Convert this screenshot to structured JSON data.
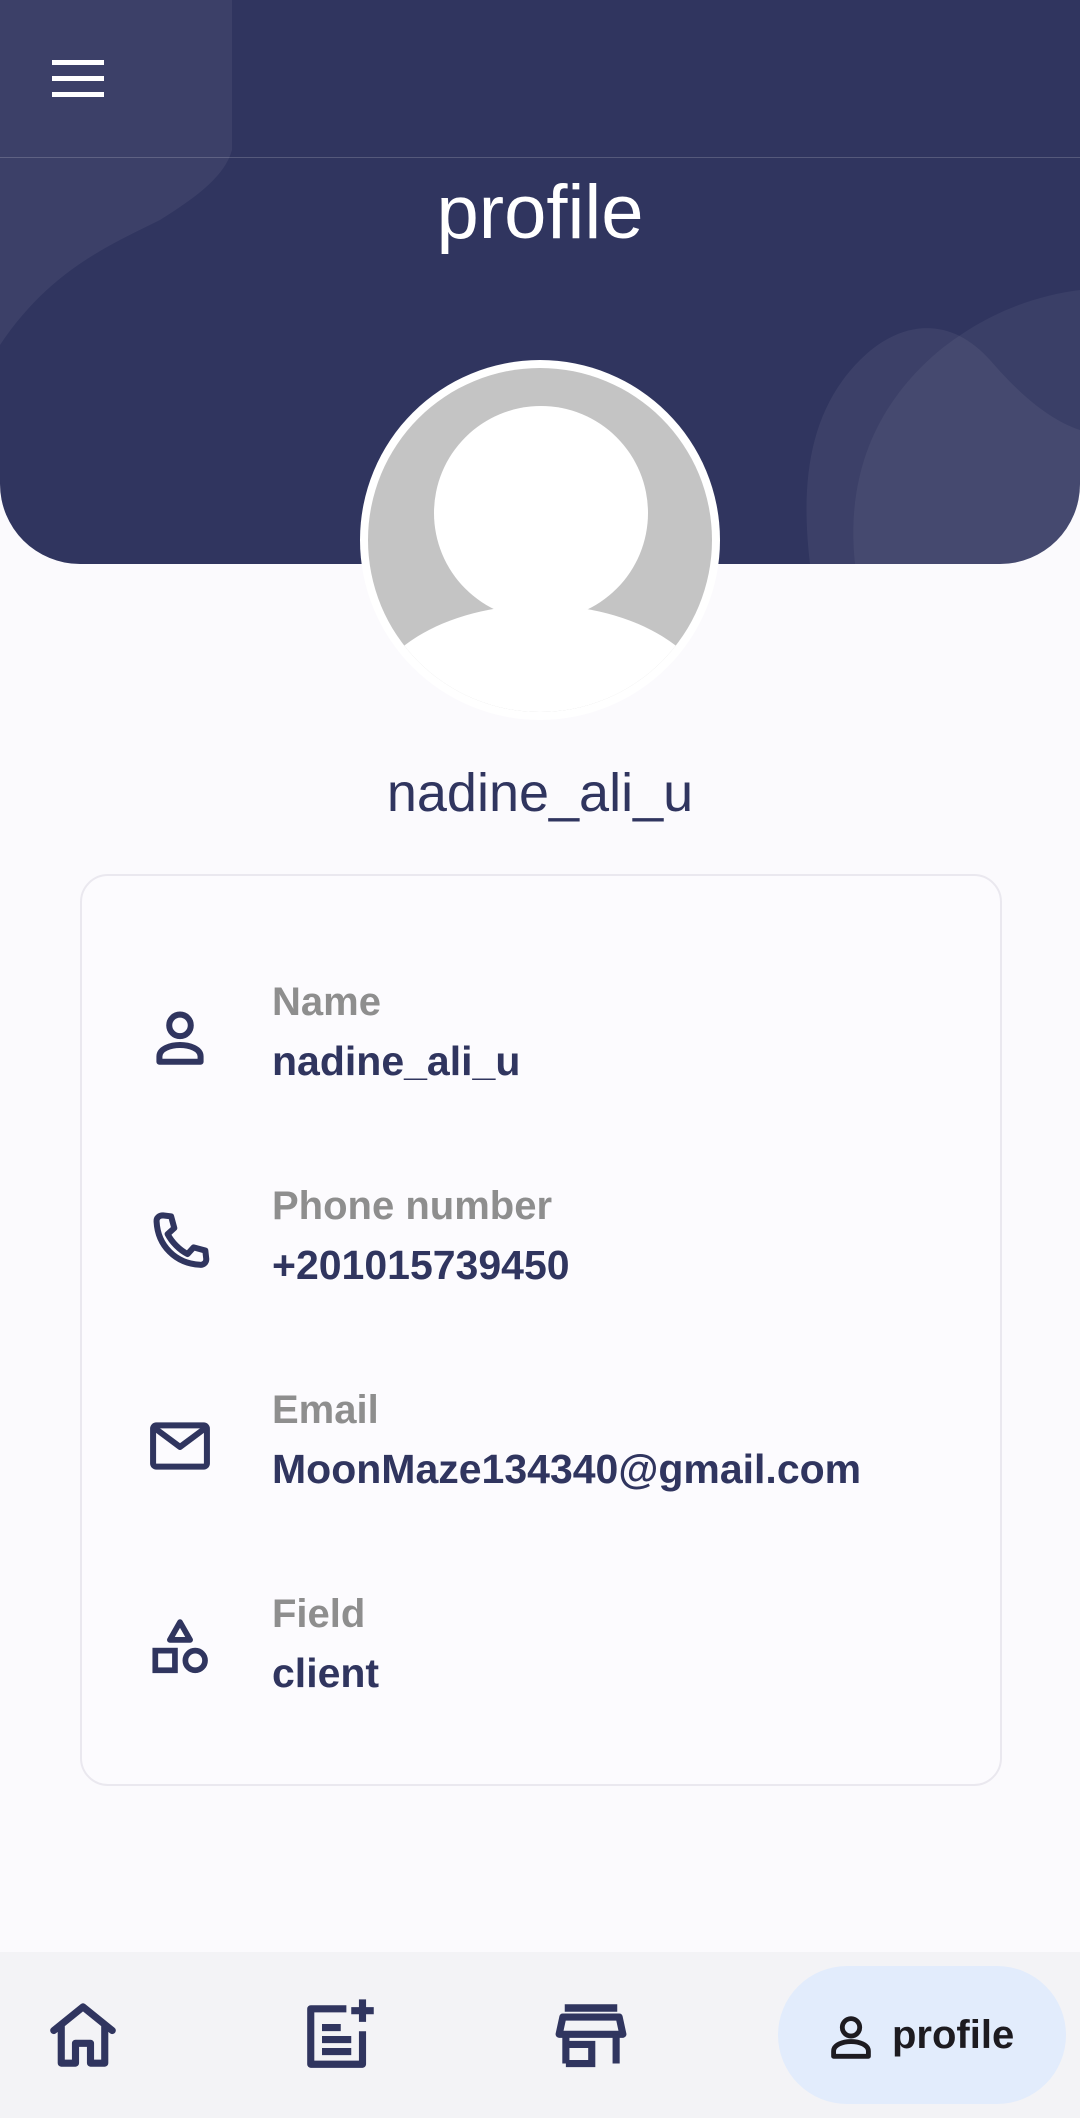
{
  "header": {
    "title": "profile"
  },
  "profile": {
    "username": "nadine_ali_u"
  },
  "details": [
    {
      "icon": "person-icon",
      "label": "Name",
      "value": "nadine_ali_u"
    },
    {
      "icon": "phone-icon",
      "label": "Phone number",
      "value": "+201015739450"
    },
    {
      "icon": "email-icon",
      "label": "Email",
      "value": "MoonMaze134340@gmail.com"
    },
    {
      "icon": "shapes-icon",
      "label": "Field",
      "value": "client"
    }
  ],
  "bottom_nav": {
    "items": [
      {
        "icon": "home-icon"
      },
      {
        "icon": "add-post-icon"
      },
      {
        "icon": "store-icon"
      },
      {
        "icon": "person-icon",
        "label": "profile",
        "active": true
      }
    ]
  },
  "colors": {
    "primary": "#30355F",
    "background": "#FBFAFD",
    "label": "#8E8E8E",
    "active_pill": "#E2ECFC"
  }
}
